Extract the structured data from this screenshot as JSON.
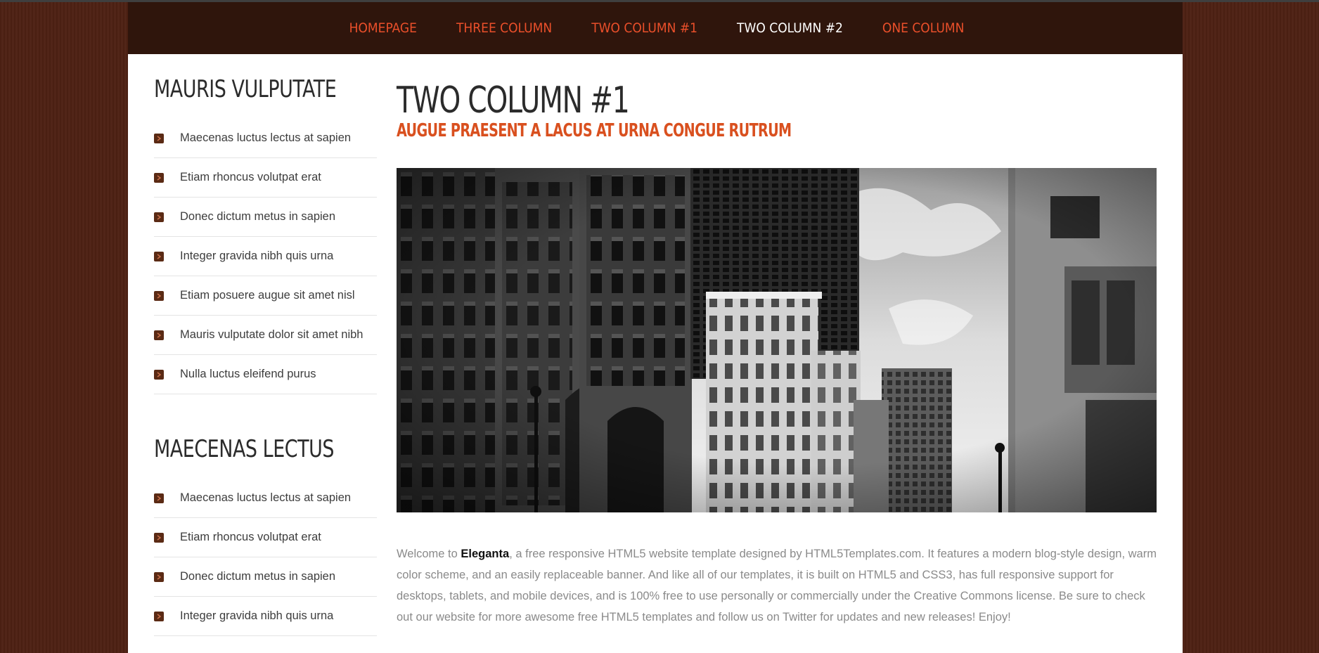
{
  "nav": {
    "items": [
      {
        "label": "HOMEPAGE",
        "active": false
      },
      {
        "label": "THREE COLUMN",
        "active": false
      },
      {
        "label": "TWO COLUMN #1",
        "active": false
      },
      {
        "label": "TWO COLUMN #2",
        "active": true
      },
      {
        "label": "ONE COLUMN",
        "active": false
      }
    ]
  },
  "sidebar": {
    "sections": [
      {
        "title": "MAURIS VULPUTATE",
        "items": [
          "Maecenas luctus lectus at sapien",
          "Etiam rhoncus volutpat erat",
          "Donec dictum metus in sapien",
          "Integer gravida nibh quis urna",
          "Etiam posuere augue sit amet nisl",
          "Mauris vulputate dolor sit amet nibh",
          "Nulla luctus eleifend purus"
        ]
      },
      {
        "title": "MAECENAS LECTUS",
        "items": [
          "Maecenas luctus lectus at sapien",
          "Etiam rhoncus volutpat erat",
          "Donec dictum metus in sapien",
          "Integer gravida nibh quis urna"
        ]
      }
    ]
  },
  "main": {
    "title": "TWO COLUMN #1",
    "subtitle": "AUGUE PRAESENT A LACUS AT URNA CONGUE RUTRUM",
    "intro_prefix": "Welcome to ",
    "intro_brand": "Eleganta",
    "intro_rest": ", a free responsive HTML5 website template designed by HTML5Templates.com. It features a modern blog-style design, warm color scheme, and an easily replaceable banner. And like all of our templates, it is built on HTML5 and CSS3, has full responsive support for desktops, tablets, and mobile devices, and is 100% free to use personally or commercially under the Creative Commons license. Be sure to check out our website for more awesome free HTML5 templates and follow us on Twitter for updates and new releases! Enjoy!"
  },
  "colors": {
    "background": "#4e2113",
    "header": "#2f150c",
    "nav_link": "#ea4f2a",
    "nav_active": "#ffffff",
    "subtitle": "#d9501f",
    "bullet": "#5a2a14"
  },
  "icons": {
    "list_bullet": "chevron-right-icon"
  }
}
